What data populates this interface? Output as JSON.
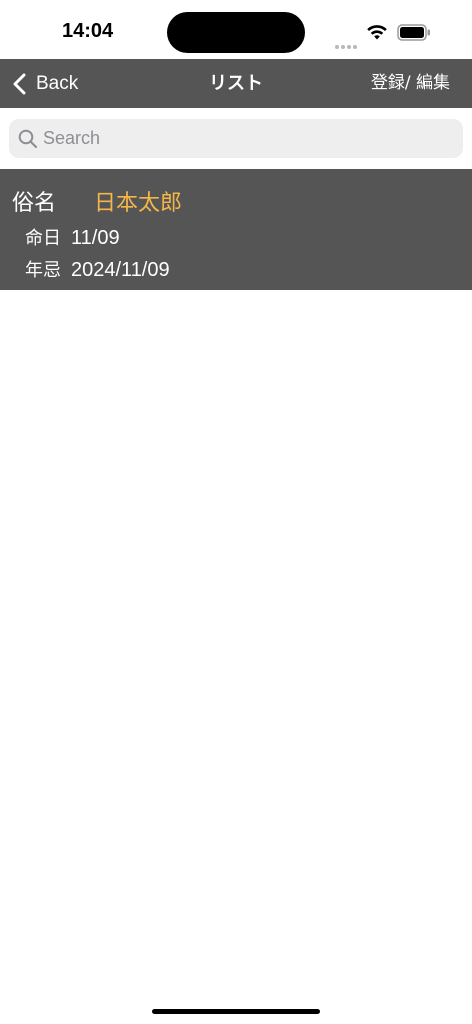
{
  "status_bar": {
    "time": "14:04"
  },
  "nav": {
    "back_label": "Back",
    "title": "リスト",
    "right_label": "登録/ 編集"
  },
  "search": {
    "placeholder": "Search",
    "value": ""
  },
  "list": {
    "items": [
      {
        "name_label": "俗名",
        "name": "日本太郎",
        "death_day_label": "命日",
        "death_day": "11/09",
        "anniversary_label": "年忌",
        "anniversary": "2024/11/09"
      }
    ]
  },
  "colors": {
    "nav_bg": "#555555",
    "accent_name": "#f4b648",
    "search_bg": "#eeeeef"
  },
  "icons": {
    "back": "chevron-left-icon",
    "search": "magnifier-icon",
    "wifi": "wifi-icon",
    "battery": "battery-icon"
  }
}
